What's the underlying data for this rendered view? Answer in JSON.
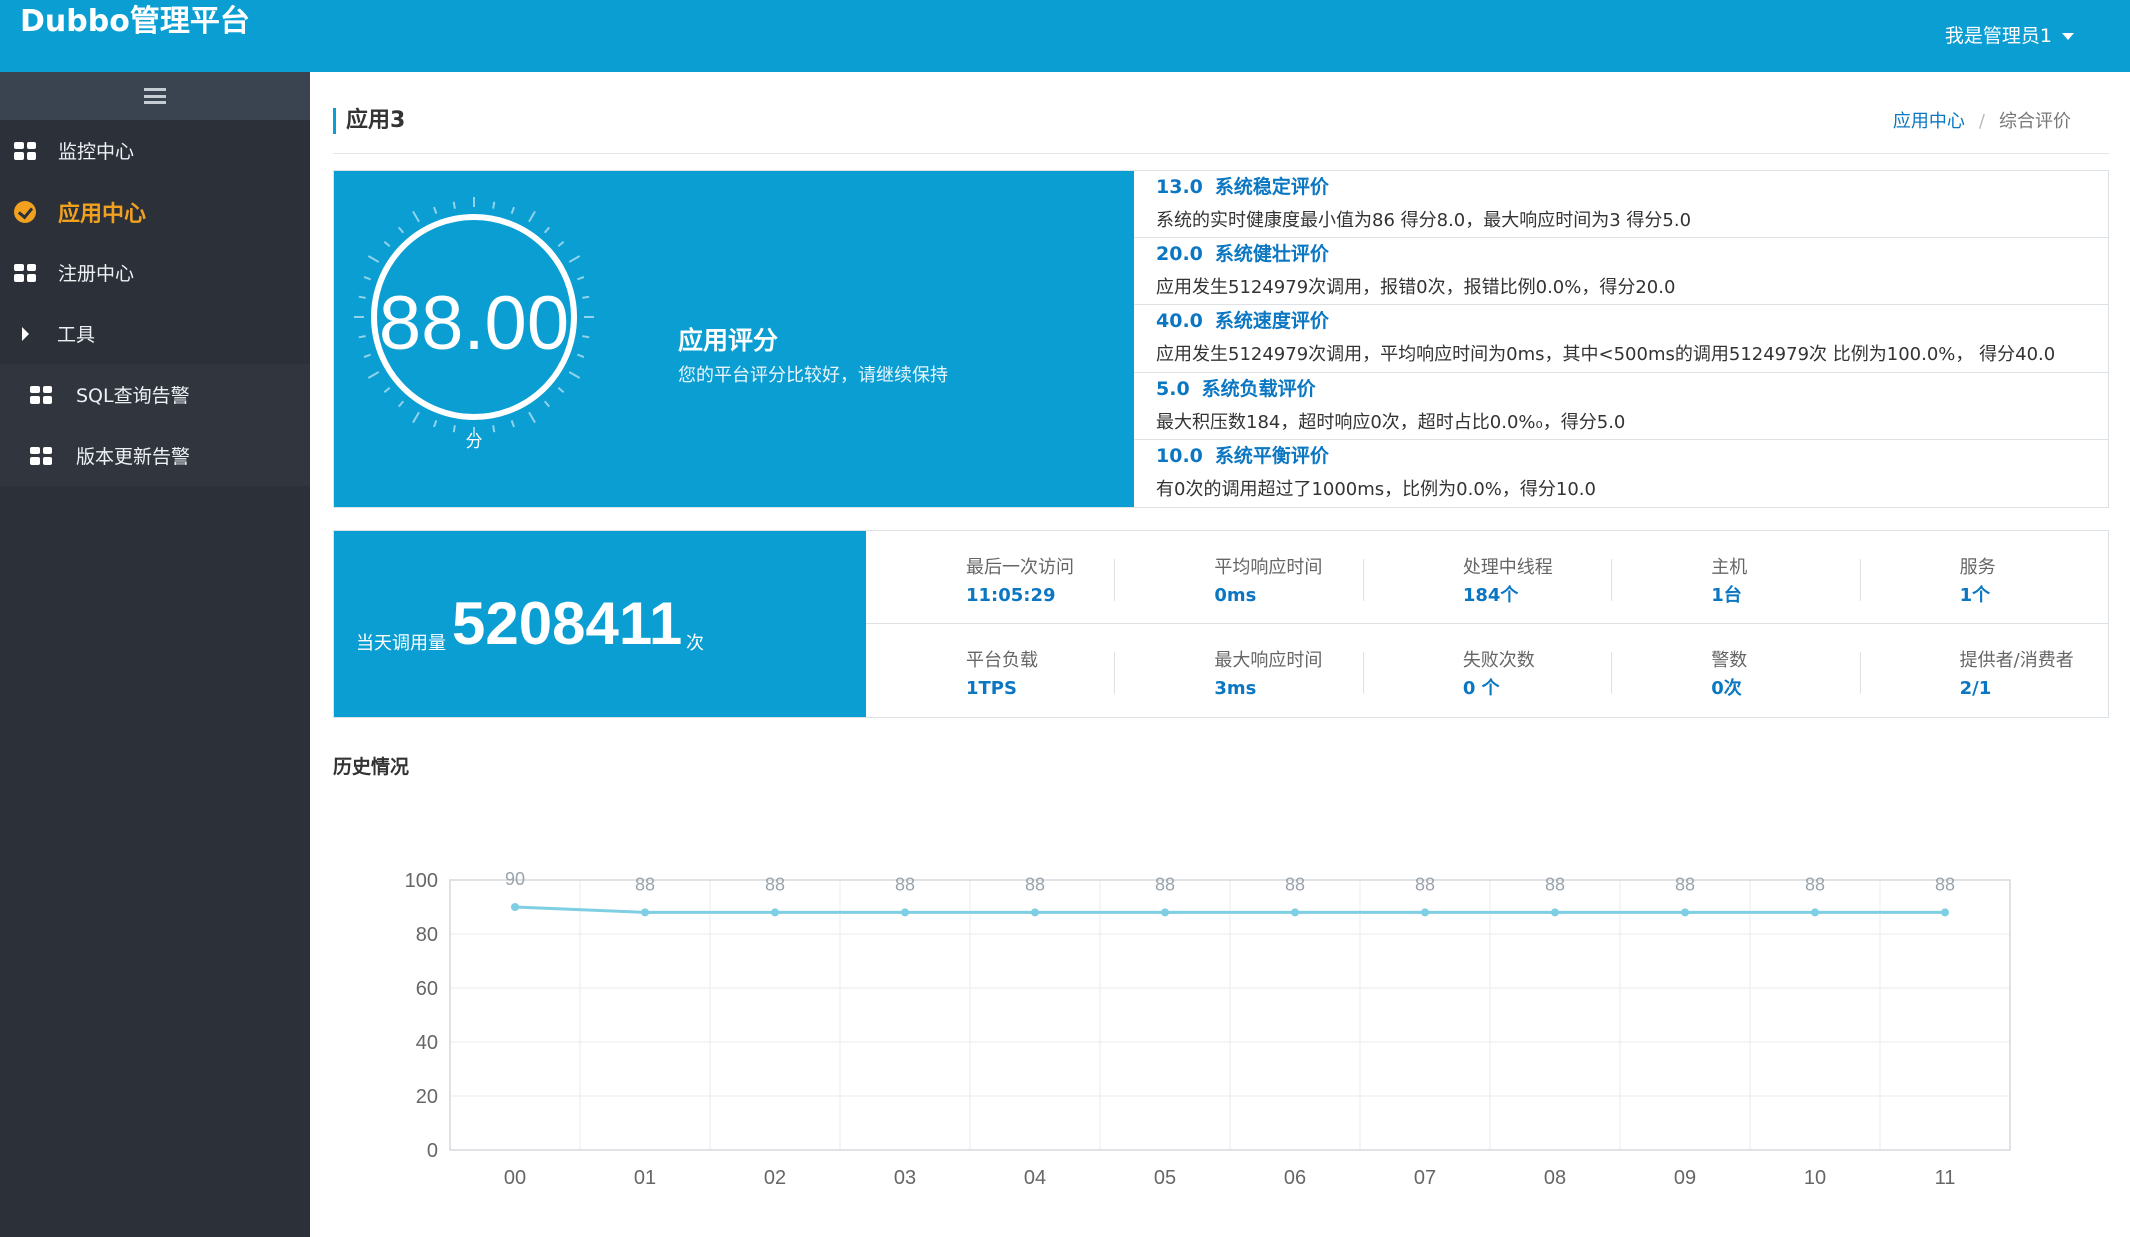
{
  "app": {
    "brand": "Dubbo管理平台",
    "user": "我是管理员1"
  },
  "sidebar": {
    "items": [
      {
        "label": "监控中心",
        "icon": "grid-icon"
      },
      {
        "label": "应用中心",
        "icon": "check-circle-icon",
        "active": true
      },
      {
        "label": "注册中心",
        "icon": "grid-icon"
      },
      {
        "label": "工具",
        "icon": "caret-right-icon"
      },
      {
        "label": "SQL查询告警",
        "icon": "grid-icon"
      },
      {
        "label": "版本更新告警",
        "icon": "grid-icon"
      }
    ]
  },
  "header": {
    "title": "应用3",
    "breadcrumb": {
      "link": "应用中心",
      "current": "综合评价"
    }
  },
  "score": {
    "value": "88.00",
    "unit": "分",
    "title": "应用评分",
    "subtitle": "您的平台评分比较好，请继续保持",
    "ring_fraction": 1.0
  },
  "evaluations": [
    {
      "score": "13.0",
      "title": "系统稳定评价",
      "desc": "系统的实时健康度最小值为86 得分8.0，最大响应时间为3 得分5.0"
    },
    {
      "score": "20.0",
      "title": "系统健壮评价",
      "desc": "应用发生5124979次调用，报错0次，报错比例0.0%，得分20.0"
    },
    {
      "score": "40.0",
      "title": "系统速度评价",
      "desc": "应用发生5124979次调用，平均响应时间为0ms，其中<500ms的调用5124979次 比例为100.0%， 得分40.0"
    },
    {
      "score": "5.0",
      "title": "系统负载评价",
      "desc": "最大积压数184，超时响应0次，超时占比0.0%₀，得分5.0"
    },
    {
      "score": "10.0",
      "title": "系统平衡评价",
      "desc": "有0次的调用超过了1000ms，比例为0.0%，得分10.0"
    }
  ],
  "today": {
    "caption": "当天调用量",
    "value": "5208411",
    "unit": "次"
  },
  "stats": [
    [
      {
        "label": "最后一次访问",
        "value": "11:05:29"
      },
      {
        "label": "平均响应时间",
        "value": "0ms"
      },
      {
        "label": "处理中线程",
        "value": "184个"
      },
      {
        "label": "主机",
        "value": "1台"
      },
      {
        "label": "服务",
        "value": "1个"
      }
    ],
    [
      {
        "label": "平台负载",
        "value": "1TPS"
      },
      {
        "label": "最大响应时间",
        "value": "3ms"
      },
      {
        "label": "失败次数",
        "value": "0 个"
      },
      {
        "label": "警数",
        "value": "0次"
      },
      {
        "label": "提供者/消费者",
        "value": "2/1"
      }
    ]
  ],
  "history": {
    "title": "历史情况"
  },
  "chart_data": {
    "type": "line",
    "title": "",
    "xlabel": "",
    "ylabel": "",
    "categories": [
      "00",
      "01",
      "02",
      "03",
      "04",
      "05",
      "06",
      "07",
      "08",
      "09",
      "10",
      "11"
    ],
    "series": [
      {
        "values": [
          90,
          88,
          88,
          88,
          88,
          88,
          88,
          88,
          88,
          88,
          88,
          88
        ]
      }
    ],
    "ylim": [
      0,
      100
    ],
    "yticks": [
      0,
      20,
      40,
      60,
      80,
      100
    ],
    "grid": true,
    "data_labels": true,
    "color": "#7ecfe3"
  },
  "colors": {
    "brand": "#0b9ed3",
    "link": "#0b77c2",
    "active": "#f2a11f",
    "sidebar": "#2b3039"
  }
}
